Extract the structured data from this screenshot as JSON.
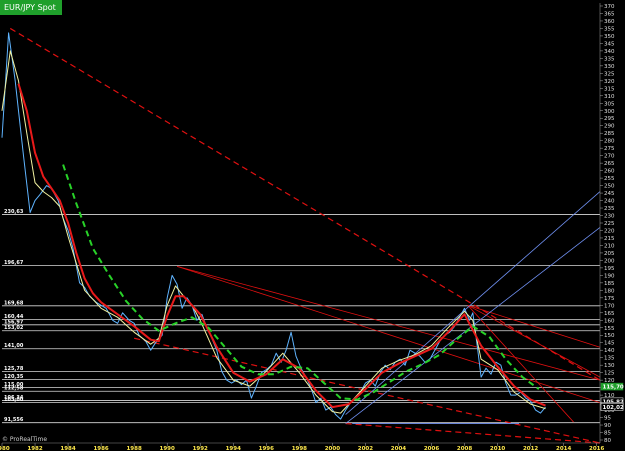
{
  "window": {
    "title": "EUR/JPY Spot",
    "watermark": "© ProRealTime"
  },
  "colors": {
    "background": "#000000",
    "title_tab": "#1f9f2b",
    "price": "#5fb4ff",
    "ma_fast": "#f2f2a0",
    "ma_slow": "#e81a1a",
    "ma_long": "#28d228",
    "trend_red": "#e01010",
    "trend_blue": "#6f8ff0",
    "level": "#d9d9d9"
  },
  "chart_data": {
    "type": "line",
    "title": "EUR/JPY Spot",
    "xlabel": "",
    "ylabel": "",
    "xlim": [
      1980,
      2016.2
    ],
    "ylim": [
      78,
      372
    ],
    "x_ticks": [
      1980,
      1982,
      1984,
      1986,
      1988,
      1990,
      1992,
      1994,
      1996,
      1998,
      2000,
      2002,
      2004,
      2006,
      2008,
      2010,
      2012,
      2014,
      2016
    ],
    "y_ticks": [
      80,
      85,
      90,
      95,
      100,
      105,
      110,
      115,
      120,
      125,
      130,
      135,
      140,
      145,
      150,
      155,
      160,
      165,
      170,
      175,
      180,
      185,
      190,
      195,
      200,
      205,
      210,
      215,
      220,
      225,
      230,
      235,
      240,
      245,
      250,
      255,
      260,
      265,
      270,
      275,
      280,
      285,
      290,
      295,
      300,
      305,
      310,
      315,
      320,
      325,
      330,
      335,
      340,
      345,
      350,
      355,
      360,
      365,
      370
    ],
    "grid": false,
    "series": [
      {
        "kind": "price",
        "x": [
          1980.0,
          1980.4,
          1980.8,
          1981.0,
          1981.3,
          1981.7,
          1982.0,
          1982.3,
          1982.7,
          1983.0,
          1983.4,
          1983.7,
          1984.0,
          1984.3,
          1984.7,
          1985.0,
          1985.3,
          1985.7,
          1986.0,
          1986.3,
          1986.7,
          1987.0,
          1987.3,
          1987.7,
          1988.0,
          1988.3,
          1988.7,
          1989.0,
          1989.3,
          1989.7,
          1990.0,
          1990.3,
          1990.6,
          1990.9,
          1991.2,
          1991.5,
          1991.8,
          1992.1,
          1992.4,
          1992.7,
          1993.0,
          1993.3,
          1993.6,
          1993.9,
          1994.2,
          1994.5,
          1994.8,
          1995.1,
          1995.4,
          1995.7,
          1996.0,
          1996.3,
          1996.6,
          1996.9,
          1997.2,
          1997.5,
          1997.8,
          1998.1,
          1998.4,
          1998.7,
          1999.0,
          1999.3,
          1999.6,
          1999.9,
          2000.2,
          2000.5,
          2000.8,
          2001.1,
          2001.4,
          2001.7,
          2002.0,
          2002.3,
          2002.6,
          2002.9,
          2003.2,
          2003.5,
          2003.8,
          2004.1,
          2004.4,
          2004.7,
          2005.0,
          2005.3,
          2005.6,
          2005.9,
          2006.2,
          2006.5,
          2006.8,
          2007.1,
          2007.4,
          2007.7,
          2008.0,
          2008.3,
          2008.5,
          2008.8,
          2009.0,
          2009.3,
          2009.6,
          2009.9,
          2010.2,
          2010.5,
          2010.8,
          2011.1,
          2011.4,
          2011.7,
          2012.0,
          2012.3,
          2012.6,
          2012.9
        ],
        "y": [
          282,
          352,
          320,
          300,
          270,
          232,
          240,
          244,
          250,
          248,
          240,
          228,
          220,
          208,
          185,
          182,
          176,
          172,
          170,
          168,
          160,
          158,
          165,
          160,
          158,
          150,
          146,
          140,
          145,
          150,
          175,
          190,
          184,
          168,
          175,
          170,
          160,
          164,
          155,
          148,
          140,
          126,
          120,
          118,
          120,
          117,
          120,
          108,
          116,
          125,
          127,
          130,
          138,
          132,
          140,
          152,
          136,
          128,
          122,
          115,
          105,
          108,
          100,
          102,
          97,
          94,
          100,
          105,
          108,
          112,
          118,
          120,
          116,
          125,
          130,
          127,
          132,
          134,
          130,
          140,
          138,
          136,
          132,
          134,
          140,
          146,
          150,
          152,
          156,
          162,
          168,
          160,
          165,
          140,
          122,
          128,
          124,
          132,
          130,
          118,
          110,
          110,
          112,
          108,
          106,
          100,
          98,
          102
        ]
      },
      {
        "kind": "ma_fast",
        "x": [
          1980.0,
          1980.5,
          1981.0,
          1981.5,
          1982.0,
          1982.5,
          1983.0,
          1983.5,
          1984.0,
          1984.5,
          1985.0,
          1985.5,
          1986.0,
          1987.0,
          1988.0,
          1989.0,
          1989.5,
          1990.0,
          1990.5,
          1991.0,
          1991.5,
          1992.0,
          1993.0,
          1994.0,
          1995.0,
          1996.0,
          1997.0,
          1998.0,
          1999.0,
          2000.0,
          2000.5,
          2001.0,
          2002.0,
          2003.0,
          2004.0,
          2005.0,
          2006.0,
          2007.0,
          2008.0,
          2008.5,
          2009.0,
          2010.0,
          2011.0,
          2012.0,
          2012.9
        ],
        "y": [
          300,
          340,
          320,
          285,
          252,
          246,
          242,
          236,
          216,
          198,
          180,
          174,
          168,
          162,
          152,
          144,
          148,
          170,
          183,
          176,
          170,
          160,
          135,
          120,
          116,
          126,
          138,
          125,
          110,
          99,
          98,
          104,
          116,
          128,
          133,
          137,
          143,
          155,
          166,
          160,
          134,
          127,
          112,
          104,
          101
        ]
      },
      {
        "kind": "ma_slow",
        "x": [
          1981.0,
          1981.5,
          1982.0,
          1982.5,
          1983.0,
          1983.5,
          1984.0,
          1984.5,
          1985.0,
          1985.5,
          1986.0,
          1987.0,
          1988.0,
          1989.0,
          1989.5,
          1990.0,
          1990.5,
          1991.0,
          1992.0,
          1993.0,
          1994.0,
          1995.0,
          1996.0,
          1997.0,
          1998.0,
          1999.0,
          2000.0,
          2001.0,
          2002.0,
          2003.0,
          2004.0,
          2005.0,
          2006.0,
          2007.0,
          2008.0,
          2009.0,
          2010.0,
          2011.0,
          2012.0,
          2012.9
        ],
        "y": [
          318,
          300,
          272,
          256,
          248,
          240,
          225,
          205,
          188,
          178,
          172,
          164,
          156,
          147,
          146,
          163,
          176,
          176,
          164,
          142,
          125,
          119,
          124,
          134,
          128,
          113,
          102,
          104,
          114,
          125,
          131,
          136,
          141,
          152,
          164,
          143,
          129,
          116,
          107,
          103
        ]
      },
      {
        "kind": "ma_long",
        "x": [
          1983.7,
          1984.5,
          1985.5,
          1986.5,
          1987.5,
          1988.5,
          1989.5,
          1990.5,
          1991.5,
          1992.5,
          1993.5,
          1994.5,
          1995.5,
          1996.5,
          1997.5,
          1998.5,
          1999.5,
          2000.5,
          2001.5,
          2002.5,
          2003.5,
          2004.5,
          2005.5,
          2006.5,
          2007.5,
          2008.5,
          2009.5,
          2010.5,
          2011.5,
          2012.5
        ],
        "y": [
          264,
          238,
          208,
          190,
          173,
          161,
          153,
          158,
          162,
          155,
          142,
          129,
          124,
          124,
          129,
          128,
          118,
          108,
          107,
          112,
          119,
          126,
          131,
          137,
          147,
          156,
          149,
          134,
          122,
          114
        ]
      }
    ],
    "levels": [
      {
        "label": "230,63",
        "value": 230.63
      },
      {
        "label": "196,67",
        "value": 196.67
      },
      {
        "label": "169,68",
        "value": 169.68
      },
      {
        "label": "160,44",
        "value": 160.44
      },
      {
        "label": "156,97",
        "value": 156.97
      },
      {
        "label": "153,02",
        "value": 153.02
      },
      {
        "label": "141,00",
        "value": 141.0
      },
      {
        "label": "125,78",
        "value": 125.78
      },
      {
        "label": "120,35",
        "value": 120.35
      },
      {
        "label": "115,00",
        "value": 115.0
      },
      {
        "label": "112,58",
        "value": 112.58
      },
      {
        "label": "106,34",
        "value": 106.34
      },
      {
        "label": "105,00",
        "value": 105.0
      },
      {
        "label": "91,556",
        "value": 91.556
      }
    ],
    "trendlines": [
      {
        "color": "red",
        "dash": true,
        "x1": 1980.5,
        "y1": 355,
        "x2": 2016.2,
        "y2": 120
      },
      {
        "color": "red",
        "dash": false,
        "x1": 1990.6,
        "y1": 196,
        "x2": 2016.2,
        "y2": 120
      },
      {
        "color": "red",
        "dash": false,
        "x1": 1990.6,
        "y1": 196,
        "x2": 2016.2,
        "y2": 105
      },
      {
        "color": "red",
        "dash": true,
        "x1": 2000.8,
        "y1": 91,
        "x2": 2016.2,
        "y2": 78
      },
      {
        "color": "red",
        "dash": true,
        "x1": 1988.0,
        "y1": 148,
        "x2": 2016.2,
        "y2": 78
      },
      {
        "color": "red",
        "dash": false,
        "x1": 2008.2,
        "y1": 170,
        "x2": 2016.2,
        "y2": 142
      },
      {
        "color": "red",
        "dash": false,
        "x1": 2008.2,
        "y1": 170,
        "x2": 2016.2,
        "y2": 122
      },
      {
        "color": "red",
        "dash": false,
        "x1": 2008.2,
        "y1": 170,
        "x2": 2014.6,
        "y2": 92
      },
      {
        "color": "blue",
        "dash": false,
        "x1": 2000.8,
        "y1": 97,
        "x2": 2016.2,
        "y2": 246
      },
      {
        "color": "blue",
        "dash": false,
        "x1": 2000.8,
        "y1": 91,
        "x2": 2016.2,
        "y2": 222
      },
      {
        "color": "blue",
        "dash": false,
        "x1": 2001.2,
        "y1": 91,
        "x2": 2011.3,
        "y2": 91
      }
    ],
    "price_tags": [
      {
        "label": "115,70",
        "value": 115.7,
        "color": "#1f9f2b"
      },
      {
        "label": "105,82",
        "value": 105.82,
        "color": "#ffffff"
      },
      {
        "label": "102,77",
        "value": 102.77,
        "color": "#ffffff"
      },
      {
        "label": "102,02",
        "value": 102.02,
        "color": "#ffffff"
      }
    ]
  }
}
